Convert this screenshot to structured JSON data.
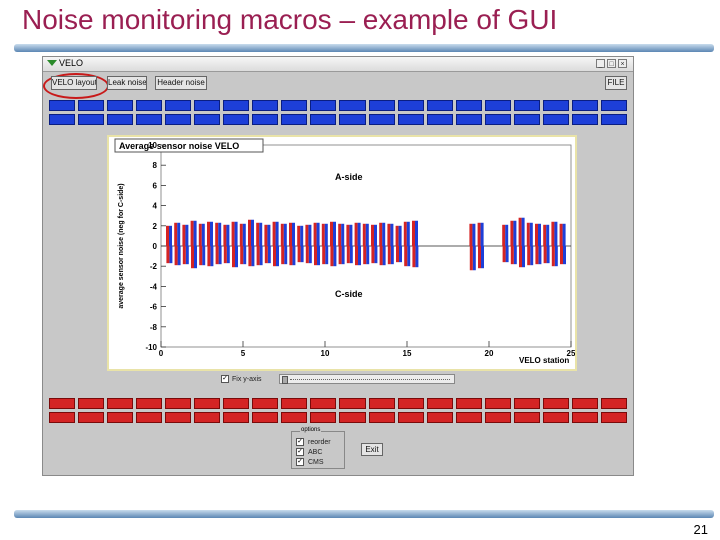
{
  "slide": {
    "title": "Noise monitoring macros – example of GUI",
    "page_number": "21"
  },
  "window": {
    "title": "VELO",
    "tabs": [
      {
        "label": "VELO layout",
        "selected": true
      },
      {
        "label": "Leak noise"
      },
      {
        "label": "Header noise"
      }
    ],
    "file_button": "FILE"
  },
  "plot": {
    "title": "Average sensor noise VELO",
    "aside_label": "A-side",
    "cside_label": "C-side"
  },
  "controls": {
    "fix_axis_label": "Fix y-axis",
    "fix_axis_checked": true,
    "slider_position": 0.02
  },
  "options": {
    "legend": "options",
    "items": [
      {
        "label": "reorder",
        "checked": true
      },
      {
        "label": "ABC",
        "checked": true
      },
      {
        "label": "CMS",
        "checked": true
      }
    ],
    "exit_label": "Exit"
  },
  "colors": {
    "title": "#9a1f52",
    "aside_bar": "#d42424",
    "cside_bar": "#1d3fd8",
    "highlight": "#c81a1a"
  },
  "chart_data": {
    "type": "bar",
    "title": "Average sensor noise VELO",
    "xlabel": "VELO station",
    "ylabel": "average sensor noise (neg for C-side)",
    "xlim": [
      0,
      25
    ],
    "ylim": [
      -10,
      10
    ],
    "xticks": [
      0,
      5,
      10,
      15,
      20,
      25
    ],
    "yticks": [
      10,
      8,
      6,
      4,
      2,
      0,
      -2,
      -4,
      -6,
      -8,
      -10
    ],
    "series": [
      {
        "name": "A-side",
        "x": [
          0.5,
          1,
          1.5,
          2,
          2.5,
          3,
          3.5,
          4,
          4.5,
          5,
          5.5,
          6,
          6.5,
          7,
          7.5,
          8,
          8.5,
          9,
          9.5,
          10,
          10.5,
          11,
          11.5,
          12,
          12.5,
          13,
          13.5,
          14,
          14.5,
          15,
          15.5,
          19,
          19.5,
          21,
          21.5,
          22,
          22.5,
          23,
          23.5,
          24,
          24.5
        ],
        "values": [
          2.0,
          2.3,
          2.1,
          2.5,
          2.2,
          2.4,
          2.3,
          2.1,
          2.4,
          2.2,
          2.6,
          2.3,
          2.1,
          2.4,
          2.2,
          2.3,
          2.0,
          2.1,
          2.3,
          2.2,
          2.4,
          2.2,
          2.1,
          2.3,
          2.2,
          2.1,
          2.3,
          2.2,
          2.0,
          2.4,
          2.5,
          2.2,
          2.3,
          2.1,
          2.5,
          2.8,
          2.3,
          2.2,
          2.1,
          2.4,
          2.2
        ]
      },
      {
        "name": "C-side",
        "x": [
          0.5,
          1,
          1.5,
          2,
          2.5,
          3,
          3.5,
          4,
          4.5,
          5,
          5.5,
          6,
          6.5,
          7,
          7.5,
          8,
          8.5,
          9,
          9.5,
          10,
          10.5,
          11,
          11.5,
          12,
          12.5,
          13,
          13.5,
          14,
          14.5,
          15,
          15.5,
          19,
          19.5,
          21,
          21.5,
          22,
          22.5,
          23,
          23.5,
          24,
          24.5
        ],
        "values": [
          -1.7,
          -1.9,
          -1.8,
          -2.2,
          -1.9,
          -2.0,
          -1.8,
          -1.7,
          -2.1,
          -1.8,
          -2.0,
          -1.9,
          -1.7,
          -2.0,
          -1.8,
          -1.9,
          -1.6,
          -1.7,
          -1.9,
          -1.8,
          -2.0,
          -1.8,
          -1.7,
          -1.9,
          -1.8,
          -1.7,
          -1.9,
          -1.8,
          -1.6,
          -2.0,
          -2.1,
          -2.4,
          -2.2,
          -1.6,
          -1.8,
          -2.1,
          -1.9,
          -1.8,
          -1.7,
          -2.0,
          -1.8
        ]
      }
    ]
  }
}
